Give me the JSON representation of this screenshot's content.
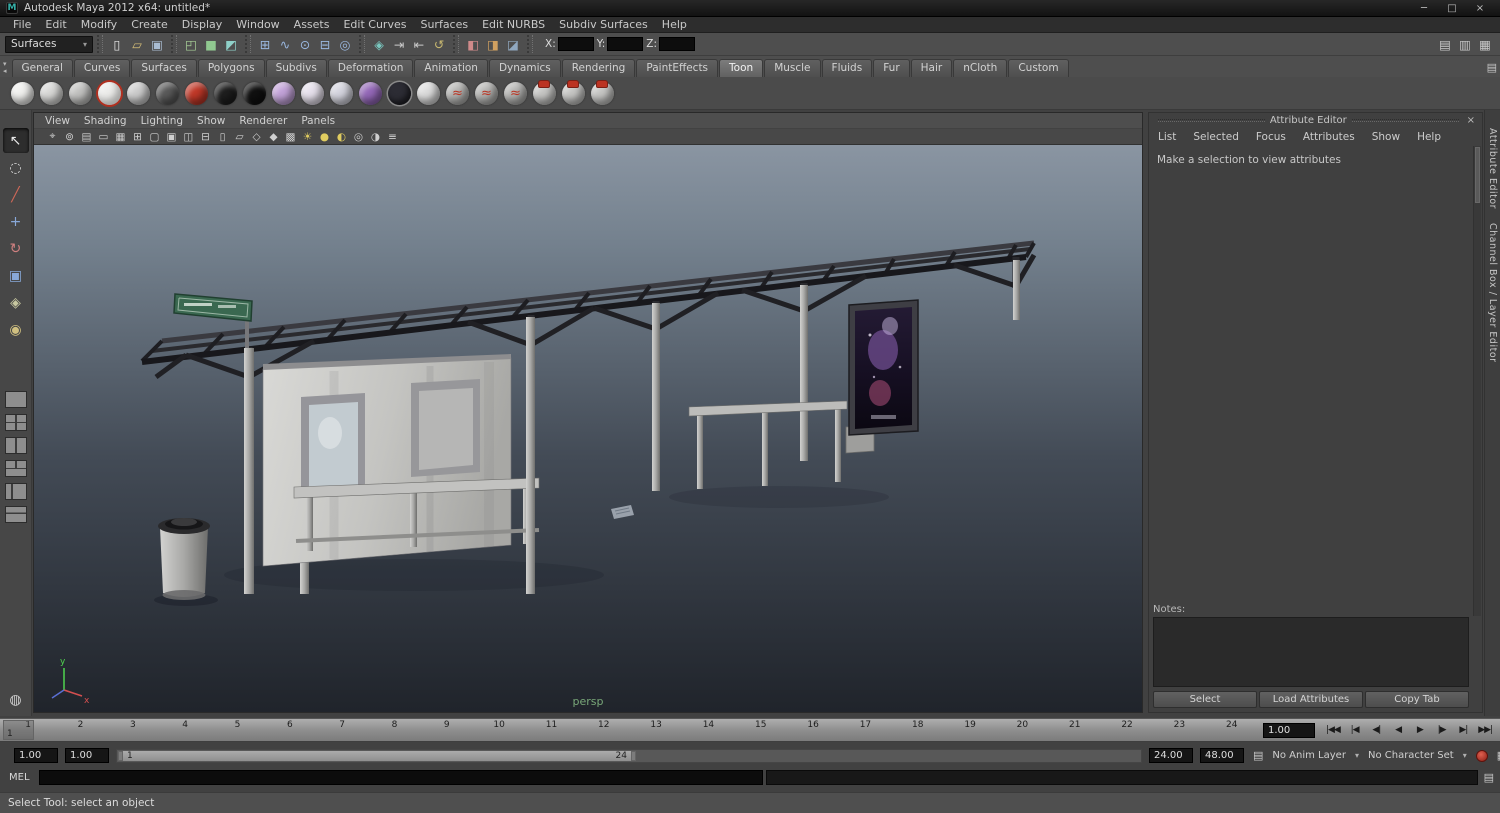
{
  "window": {
    "logo": "M",
    "title": "Autodesk Maya 2012 x64: untitled*",
    "minimize": "─",
    "maximize": "□",
    "close": "×"
  },
  "menubar": {
    "items": [
      "File",
      "Edit",
      "Modify",
      "Create",
      "Display",
      "Window",
      "Assets",
      "Edit Curves",
      "Surfaces",
      "Edit NURBS",
      "Subdiv Surfaces",
      "Help"
    ]
  },
  "statusline": {
    "menuset": "Surfaces",
    "dropdown_arrow": "▾",
    "file_icons": [
      {
        "name": "new-scene-icon",
        "glyph": "▯",
        "color": "#e8e8e8"
      },
      {
        "name": "open-scene-icon",
        "glyph": "▱",
        "color": "#d8c078"
      },
      {
        "name": "save-scene-icon",
        "glyph": "▣",
        "color": "#a9bcd2"
      }
    ],
    "select_icons": [
      {
        "name": "select-hierarchy-icon",
        "glyph": "◰",
        "color": "#a8d098"
      },
      {
        "name": "select-object-icon",
        "glyph": "■",
        "color": "#90c890"
      },
      {
        "name": "select-component-icon",
        "glyph": "◩",
        "color": "#8fd0c8"
      }
    ],
    "snap_icons": [
      {
        "name": "snap-to-grid-icon",
        "glyph": "⊞",
        "color": "#9ab8e0"
      },
      {
        "name": "snap-to-curves-icon",
        "glyph": "∿",
        "color": "#9ab8e0"
      },
      {
        "name": "snap-to-points-icon",
        "glyph": "⊙",
        "color": "#9ab8e0"
      },
      {
        "name": "snap-to-view-planes-icon",
        "glyph": "⊟",
        "color": "#9ab8e0"
      },
      {
        "name": "snap-to-surfaces-icon",
        "glyph": "◎",
        "color": "#9ab8e0"
      }
    ],
    "history_icons": [
      {
        "name": "make-live-icon",
        "glyph": "◈",
        "color": "#7ac8c0"
      },
      {
        "name": "input-connections-icon",
        "glyph": "⇥",
        "color": "#c8c8c8"
      },
      {
        "name": "output-connections-icon",
        "glyph": "⇤",
        "color": "#c8c8c8"
      },
      {
        "name": "construction-history-icon",
        "glyph": "↺",
        "color": "#c8b870"
      }
    ],
    "render_icons": [
      {
        "name": "render-current-frame-icon",
        "glyph": "◧",
        "color": "#d08a8a"
      },
      {
        "name": "ipr-render-icon",
        "glyph": "◨",
        "color": "#d0a060"
      },
      {
        "name": "render-settings-icon",
        "glyph": "◪",
        "color": "#90a8c0"
      }
    ],
    "coords": [
      {
        "label": "X:"
      },
      {
        "label": "Y:"
      },
      {
        "label": "Z:"
      }
    ],
    "right_icons": [
      {
        "name": "toggle-attribute-editor-icon",
        "glyph": "▤",
        "color": "#c8c8c8"
      },
      {
        "name": "toggle-tool-settings-icon",
        "glyph": "▥",
        "color": "#c8c8c8"
      },
      {
        "name": "toggle-channel-box-icon",
        "glyph": "▦",
        "color": "#c8c8c8"
      }
    ]
  },
  "shelf": {
    "left_buttons": [
      {
        "name": "shelf-tab-menu-icon",
        "glyph": "▾"
      },
      {
        "name": "shelf-item-menu-icon",
        "glyph": "◂"
      }
    ],
    "options_icon": "▤",
    "tabs": [
      {
        "label": "General"
      },
      {
        "label": "Curves"
      },
      {
        "label": "Surfaces"
      },
      {
        "label": "Polygons"
      },
      {
        "label": "Subdivs"
      },
      {
        "label": "Deformation"
      },
      {
        "label": "Animation"
      },
      {
        "label": "Dynamics"
      },
      {
        "label": "Rendering"
      },
      {
        "label": "PaintEffects"
      },
      {
        "label": "Toon",
        "active": true
      },
      {
        "label": "Muscle"
      },
      {
        "label": "Fluids"
      },
      {
        "label": "Fur"
      },
      {
        "label": "Hair"
      },
      {
        "label": "nCloth"
      },
      {
        "label": "Custom"
      }
    ],
    "icons": [
      {
        "name": "toon-fill-flood-white",
        "color": "#f0f0ee"
      },
      {
        "name": "toon-fill-flood-light",
        "color": "#d8d8d6"
      },
      {
        "name": "toon-fill-shaded-brightness",
        "color": "#c2c2c0"
      },
      {
        "name": "toon-fill-solid-outline",
        "color": "#ececea"
      },
      {
        "name": "toon-fill-light-angle",
        "color": "#cccccc"
      },
      {
        "name": "toon-fill-dark-profile",
        "color": "#5a5a5a"
      },
      {
        "name": "toon-fill-rim-red",
        "color": "#c03828"
      },
      {
        "name": "toon-outline-offset",
        "color": "#1e1e1e"
      },
      {
        "name": "toon-outline-black",
        "color": "#101010"
      },
      {
        "name": "toon-assign-fill-shader",
        "color": "#c2a2d8"
      },
      {
        "name": "toon-assign-outline",
        "color": "#e6e0ec"
      },
      {
        "name": "toon-set-camera-background",
        "color": "#d4d4de"
      },
      {
        "name": "toon-reverse-surfaces",
        "color": "#9468b8"
      },
      {
        "name": "toon-hide-outlines",
        "color": "#2c2c34"
      },
      {
        "name": "toon-crease-set",
        "color": "#dcdcdc"
      },
      {
        "name": "toon-line-width-modifier",
        "color": "#b4b4b2"
      },
      {
        "name": "toon-line-opacity-modifier",
        "color": "#b4b4b2"
      },
      {
        "name": "toon-line-offset-modifier",
        "color": "#b4b4b2"
      },
      {
        "name": "toon-paintfx-marker-1",
        "color": "#c6c6c4"
      },
      {
        "name": "toon-paintfx-marker-2",
        "color": "#c6c6c4"
      },
      {
        "name": "toon-paintfx-marker-3",
        "color": "#c6c6c4"
      }
    ]
  },
  "toolbox": {
    "tools": [
      {
        "name": "select-tool",
        "glyph": "↖",
        "color": "#e8e8e8",
        "active": true
      },
      {
        "name": "lasso-tool",
        "glyph": "◌",
        "color": "#d8d8d8"
      },
      {
        "name": "paint-selection-tool",
        "glyph": "╱",
        "color": "#d06858"
      },
      {
        "name": "move-tool",
        "glyph": "+",
        "color": "#88a8d8"
      },
      {
        "name": "rotate-tool",
        "glyph": "↻",
        "color": "#d08080"
      },
      {
        "name": "scale-tool",
        "glyph": "▣",
        "color": "#88a8d8"
      },
      {
        "name": "universal-manipulator-tool",
        "glyph": "◈",
        "color": "#c8c8a0"
      },
      {
        "name": "soft-modification-tool",
        "glyph": "◉",
        "color": "#d0c080"
      }
    ],
    "layouts": [
      {
        "name": "single-pane-layout"
      },
      {
        "name": "four-pane-layout"
      },
      {
        "name": "two-pane-side-by-side-layout"
      },
      {
        "name": "three-pane-split-layout"
      },
      {
        "name": "persp-outliner-layout"
      },
      {
        "name": "hypershade-persp-layout"
      }
    ],
    "bottom_icon": {
      "name": "outliner-panel-icon",
      "glyph": "◍"
    }
  },
  "panel": {
    "menus": [
      "View",
      "Shading",
      "Lighting",
      "Show",
      "Renderer",
      "Panels"
    ],
    "toolbar_icons": [
      {
        "name": "select-camera-icon",
        "glyph": "⌖"
      },
      {
        "name": "lock-camera-icon",
        "glyph": "⊚"
      },
      {
        "name": "camera-attributes-icon",
        "glyph": "▤"
      },
      {
        "name": "bookmarks-icon",
        "glyph": "▭"
      },
      {
        "name": "image-plane-icon",
        "glyph": "▦"
      },
      {
        "name": "grid-icon",
        "glyph": "⊞"
      },
      {
        "name": "film-gate-icon",
        "glyph": "▢"
      },
      {
        "name": "resolution-gate-icon",
        "glyph": "▣"
      },
      {
        "name": "gate-mask-icon",
        "glyph": "◫"
      },
      {
        "name": "field-chart-icon",
        "glyph": "⊟"
      },
      {
        "name": "safe-action-icon",
        "glyph": "▯"
      },
      {
        "name": "safe-title-icon",
        "glyph": "▱"
      },
      {
        "name": "wireframe-icon",
        "glyph": "◇"
      },
      {
        "name": "shaded-icon",
        "glyph": "◆"
      },
      {
        "name": "textured-icon",
        "glyph": "▩"
      },
      {
        "name": "use-all-lights-icon",
        "glyph": "☀",
        "color": "#e0cc60"
      },
      {
        "name": "shadows-icon",
        "glyph": "●",
        "color": "#e0cc60"
      },
      {
        "name": "textures-icon",
        "glyph": "◐",
        "color": "#e0cc60"
      },
      {
        "name": "isolate-select-icon",
        "glyph": "◎"
      },
      {
        "name": "xray-icon",
        "glyph": "◑"
      },
      {
        "name": "exposure-icon",
        "glyph": "≡"
      }
    ],
    "camera": "persp",
    "axis_y": "y",
    "axis_x": "x"
  },
  "attribute_editor": {
    "title": "Attribute Editor",
    "close": "×",
    "menus": [
      "List",
      "Selected",
      "Focus",
      "Attributes",
      "Show",
      "Help"
    ],
    "message": "Make a selection to view attributes",
    "notes_label": "Notes:",
    "select_button": "Select",
    "load_attributes_button": "Load Attributes",
    "copy_tab_button": "Copy Tab"
  },
  "side_tabs": [
    "Attribute Editor",
    "Channel Box / Layer Editor"
  ],
  "timeline": {
    "ticks": [
      "1",
      "2",
      "3",
      "4",
      "5",
      "6",
      "7",
      "8",
      "9",
      "10",
      "11",
      "12",
      "13",
      "14",
      "15",
      "16",
      "17",
      "18",
      "19",
      "20",
      "21",
      "22",
      "23",
      "24"
    ],
    "current_frame": "1",
    "current_time": "1.00",
    "playback": [
      {
        "name": "go-to-start-button",
        "glyph": "|◀◀"
      },
      {
        "name": "step-back-frame-button",
        "glyph": "|◀"
      },
      {
        "name": "step-back-key-button",
        "glyph": "◀|"
      },
      {
        "name": "play-backwards-button",
        "glyph": "◀"
      },
      {
        "name": "play-forwards-button",
        "glyph": "▶"
      },
      {
        "name": "step-forward-key-button",
        "glyph": "|▶"
      },
      {
        "name": "step-forward-frame-button",
        "glyph": "▶|"
      },
      {
        "name": "go-to-end-button",
        "glyph": "▶▶|"
      }
    ]
  },
  "range_slider": {
    "animation_start": "1.00",
    "playback_start": "1.00",
    "range_start_label": "1",
    "range_end_label": "24",
    "playback_end": "24.00",
    "animation_end": "48.00",
    "anim_layer_icon": "▤",
    "anim_layer_label": "No Anim Layer",
    "character_set_label": "No Character Set",
    "dropdown_arrow": "▾",
    "preferences_icon": "▦"
  },
  "command_line": {
    "label": "MEL",
    "script_editor_icon": "▤"
  },
  "help_line": {
    "text": "Select Tool: select an object"
  }
}
